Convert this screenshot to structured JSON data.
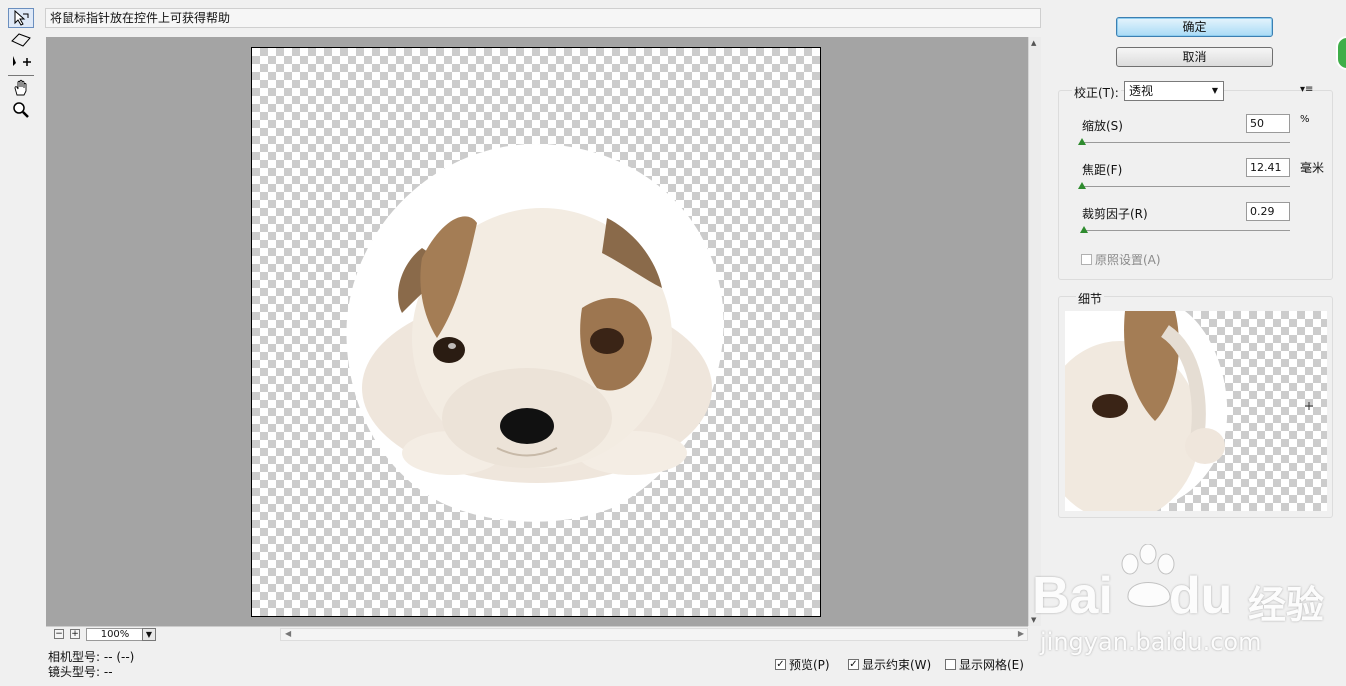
{
  "hint": "将鼠标指针放在控件上可获得帮助",
  "tools": [
    "pointer-tool",
    "polygon-tool",
    "move-tool",
    "hand-tool",
    "zoom-tool"
  ],
  "status": {
    "zoom": "100%",
    "zoom_out": "−",
    "zoom_in": "+"
  },
  "camera": {
    "camera_model": "相机型号: -- (--)",
    "lens_model": "镜头型号: --"
  },
  "bottom_options": {
    "preview": "预览(P)",
    "show_constraints": "显示约束(W)",
    "show_grid": "显示网格(E)"
  },
  "buttons": {
    "ok": "确定",
    "cancel": "取消"
  },
  "correction": {
    "label": "校正(T):",
    "value": "透视",
    "menu_icon": "▾≡",
    "params": [
      {
        "label": "缩放(S)",
        "value": "50",
        "unit": "%",
        "level": 0.0
      },
      {
        "label": "焦距(F)",
        "value": "12.41",
        "unit": "毫米",
        "level": 0.0
      },
      {
        "label": "裁剪因子(R)",
        "value": "0.29",
        "unit": "",
        "level": 0.01
      }
    ],
    "as_shot": "原照设置(A)"
  },
  "detail": {
    "label": "细节"
  },
  "watermark": {
    "brand": "Bai",
    "brand2": "du",
    "cn": "经验",
    "url": "jingyan.baidu.com"
  },
  "colors": {
    "accent": "#3c7fb1",
    "canvas_bg": "#a4a4a4",
    "slider_thumb": "#2e8b2e"
  }
}
